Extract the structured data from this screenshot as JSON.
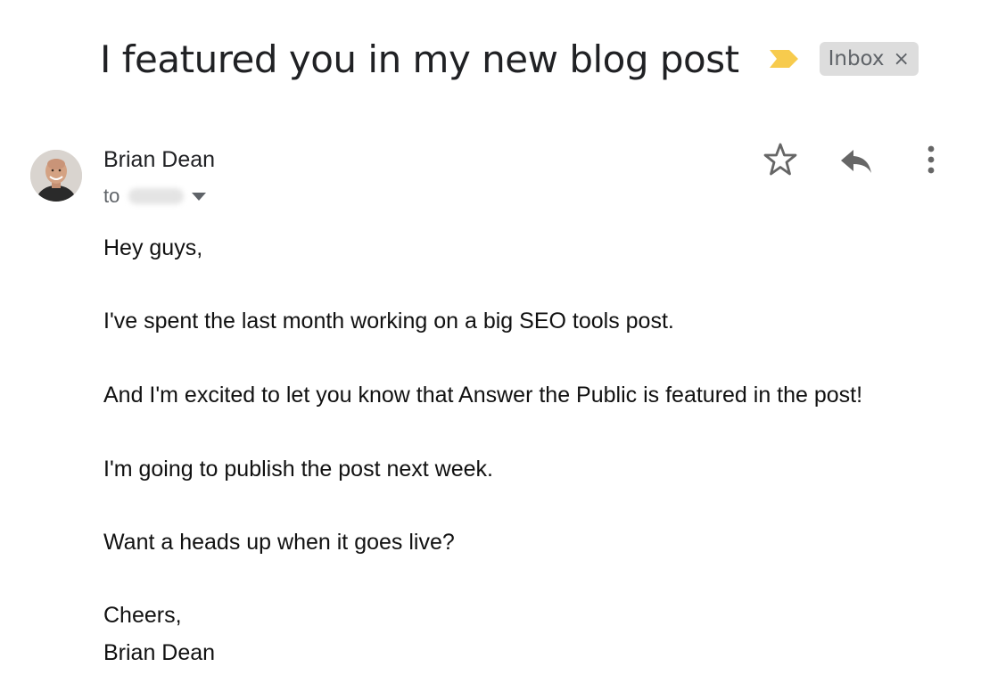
{
  "email": {
    "subject": "I featured you in my new blog post",
    "labels": [
      {
        "name": "Inbox",
        "remove_glyph": "×"
      }
    ],
    "importance_marker": {
      "icon": "importance-marker-icon",
      "color": "#f7cb4d"
    },
    "sender": {
      "name": "Brian Dean",
      "avatar": "avatar"
    },
    "recipient": {
      "prefix": "to"
    },
    "actions": [
      {
        "name": "star",
        "icon": "star-icon"
      },
      {
        "name": "reply",
        "icon": "reply-icon"
      },
      {
        "name": "more",
        "icon": "more-vertical-icon"
      }
    ],
    "body": {
      "greeting": "Hey guys,",
      "paragraphs": [
        "I've spent the last month working on a big SEO tools post.",
        "And I'm excited to let you know that Answer the Public is featured in the post!",
        "I'm going to publish the post next week.",
        "Want a heads up when it goes live?"
      ],
      "closing": "Cheers,",
      "signature": "Brian Dean"
    }
  },
  "colors": {
    "text": "#202124",
    "secondary_text": "#5f6368",
    "icon_gray": "#777777",
    "chip_background": "#dddddd",
    "marker": "#f7cb4d"
  }
}
